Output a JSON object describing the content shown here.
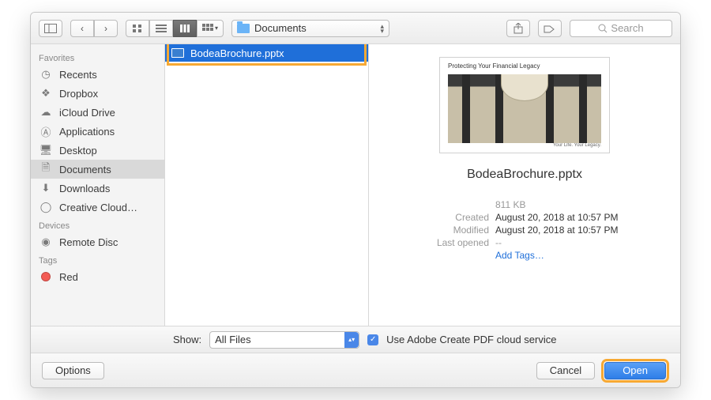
{
  "toolbar": {
    "path_label": "Documents",
    "search_placeholder": "Search"
  },
  "sidebar": {
    "sections": [
      {
        "header": "Favorites",
        "items": [
          {
            "icon": "clock",
            "label": "Recents"
          },
          {
            "icon": "dropbox",
            "label": "Dropbox"
          },
          {
            "icon": "cloud",
            "label": "iCloud Drive"
          },
          {
            "icon": "app",
            "label": "Applications"
          },
          {
            "icon": "desktop",
            "label": "Desktop"
          },
          {
            "icon": "doc",
            "label": "Documents",
            "selected": true
          },
          {
            "icon": "download",
            "label": "Downloads"
          },
          {
            "icon": "cc",
            "label": "Creative Cloud…"
          }
        ]
      },
      {
        "header": "Devices",
        "items": [
          {
            "icon": "disc",
            "label": "Remote Disc"
          }
        ]
      },
      {
        "header": "Tags",
        "items": [
          {
            "icon": "tag",
            "label": "Red",
            "color": "#f35b54"
          }
        ]
      }
    ]
  },
  "filelist": {
    "items": [
      {
        "name": "BodeaBrochure.pptx",
        "selected": true
      }
    ]
  },
  "preview": {
    "thumb_title": "Protecting Your Financial Legacy",
    "thumb_footer": "Your Life. Your Legacy.",
    "filename": "BodeaBrochure.pptx",
    "size": "811 KB",
    "meta": [
      {
        "label": "Created",
        "value": "August 20, 2018 at 10:57 PM"
      },
      {
        "label": "Modified",
        "value": "August 20, 2018 at 10:57 PM"
      },
      {
        "label": "Last opened",
        "value": "--",
        "muted": true
      }
    ],
    "add_tags": "Add Tags…"
  },
  "filterbar": {
    "show_label": "Show:",
    "filter_value": "All Files",
    "checkbox_label": "Use Adobe Create PDF cloud service"
  },
  "footer": {
    "options": "Options",
    "cancel": "Cancel",
    "open": "Open"
  }
}
